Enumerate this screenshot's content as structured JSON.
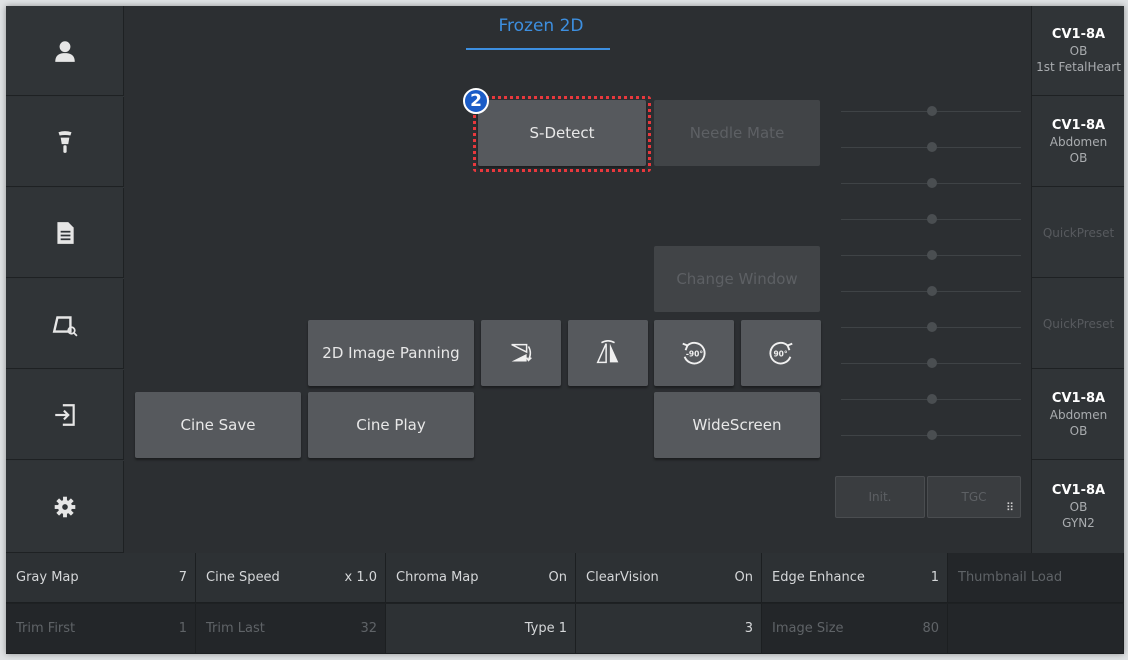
{
  "header": {
    "title": "Frozen 2D"
  },
  "sidebar": {
    "items": [
      {
        "name": "patient",
        "icon": "user-icon"
      },
      {
        "name": "probe",
        "icon": "probe-icon"
      },
      {
        "name": "report",
        "icon": "document-icon"
      },
      {
        "name": "review",
        "icon": "image-review-icon"
      },
      {
        "name": "exit",
        "icon": "exit-icon"
      },
      {
        "name": "settings",
        "icon": "gear-icon"
      }
    ]
  },
  "annotation": {
    "badge_number": "2",
    "highlight_color": "#e8383d",
    "badge_color": "#1b5cc7"
  },
  "buttons": {
    "s_detect": "S-Detect",
    "needle_mate": "Needle Mate",
    "change_window": "Change Window",
    "image_panning": "2D Image Panning",
    "flip_horizontal_icon": "flip-horizontal-icon",
    "flip_vertical_icon": "flip-vertical-icon",
    "rotate_left": "-90°",
    "rotate_right": "90°",
    "cine_save": "Cine Save",
    "cine_play": "Cine Play",
    "widescreen": "WideScreen",
    "init": "Init.",
    "tgc": "TGC"
  },
  "presets": [
    {
      "l1": "CV1-8A",
      "l2": "OB",
      "l3": "1st FetalHeart"
    },
    {
      "l1": "CV1-8A",
      "l2": "Abdomen",
      "l3": "OB"
    },
    {
      "l1": "QuickPreset"
    },
    {
      "l1": "QuickPreset"
    },
    {
      "l1": "CV1-8A",
      "l2": "Abdomen",
      "l3": "OB"
    },
    {
      "l1": "CV1-8A",
      "l2": "OB",
      "l3": "GYN2"
    }
  ],
  "bottom": {
    "row1": [
      {
        "label": "Gray Map",
        "value": "7"
      },
      {
        "label": "Cine Speed",
        "value": "x 1.0"
      },
      {
        "label": "Chroma Map",
        "value": "On"
      },
      {
        "label": "ClearVision",
        "value": "On"
      },
      {
        "label": "Edge Enhance",
        "value": "1"
      },
      {
        "label": "Thumbnail Load",
        "value": ""
      }
    ],
    "row2": [
      {
        "label": "Trim First",
        "value": "1"
      },
      {
        "label": "Trim Last",
        "value": "32"
      },
      {
        "label": "",
        "value": "Type 1"
      },
      {
        "label": "",
        "value": "3"
      },
      {
        "label": "Image Size",
        "value": "80"
      },
      {
        "label": "",
        "value": ""
      }
    ]
  },
  "colors": {
    "accent": "#3d8fe0",
    "panel": "#2c2f32",
    "button": "#56595d"
  }
}
